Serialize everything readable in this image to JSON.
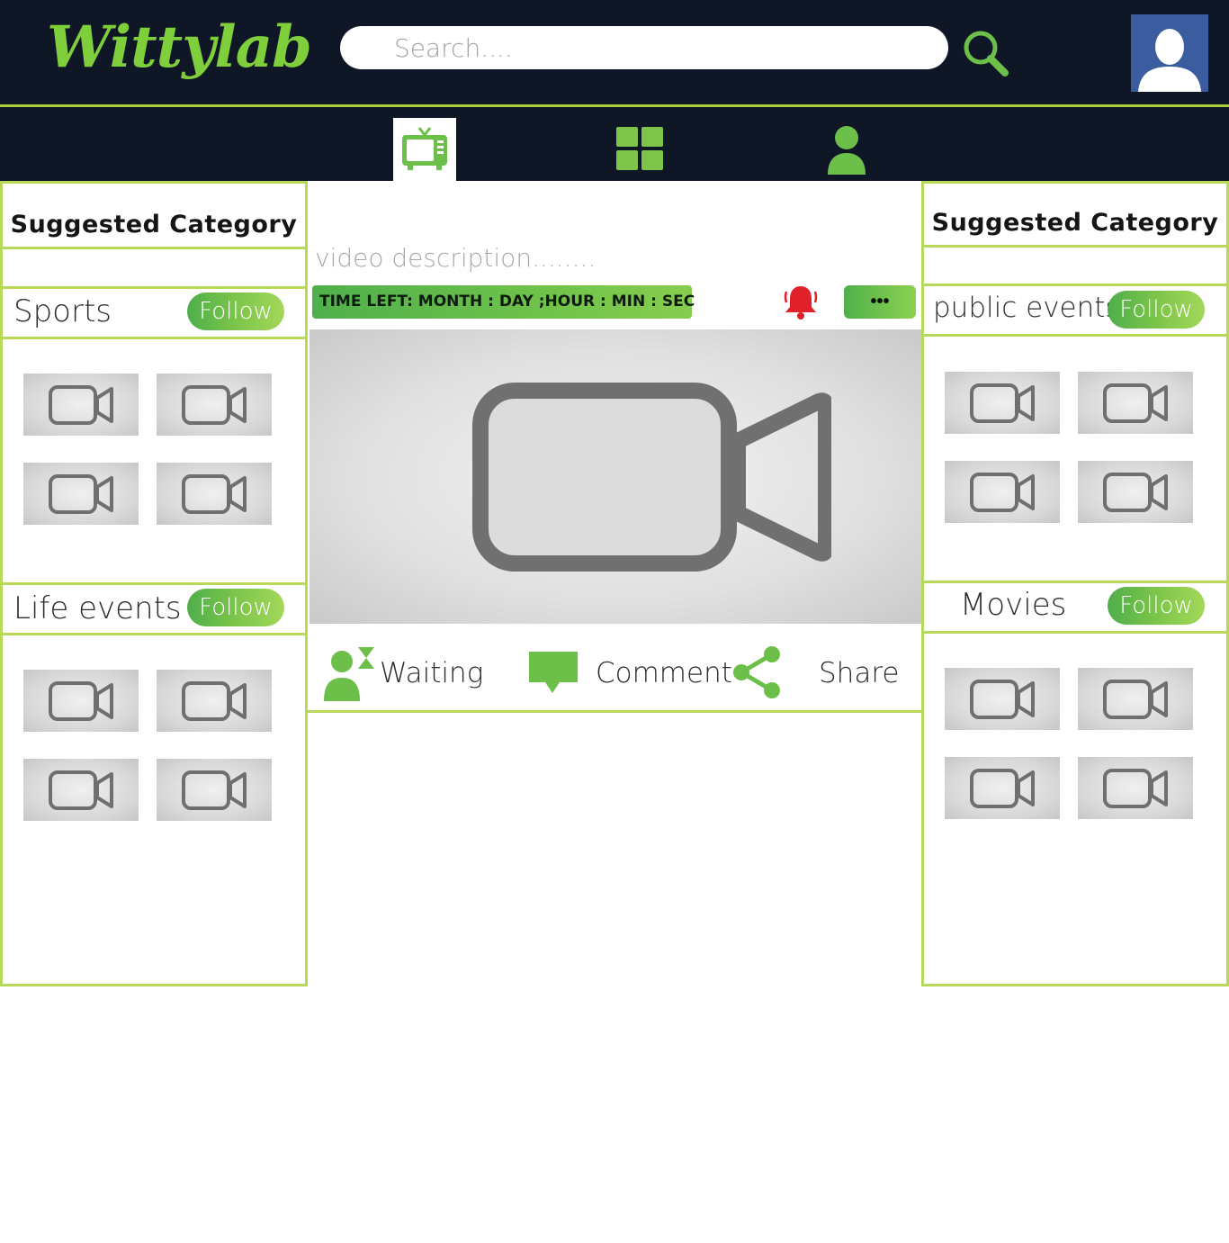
{
  "header": {
    "logo_text": "Wittylab",
    "search_placeholder": "Search....",
    "search_icon": "search-icon",
    "avatar_icon": "user-avatar-icon"
  },
  "nav": {
    "tabs": [
      {
        "icon": "tv-icon",
        "active": true
      },
      {
        "icon": "grid-icon",
        "active": false
      },
      {
        "icon": "profile-icon",
        "active": false
      }
    ]
  },
  "left_panel": {
    "title": "Suggested Category",
    "categories": [
      {
        "name": "Sports",
        "follow_label": "Follow",
        "thumbnails": 4
      },
      {
        "name": "Life events",
        "follow_label": "Follow",
        "thumbnails": 4
      }
    ]
  },
  "right_panel": {
    "title": "Suggested Category",
    "categories": [
      {
        "name": "public events",
        "follow_label": "Follow",
        "thumbnails": 4
      },
      {
        "name": "Movies",
        "follow_label": "Follow",
        "thumbnails": 4
      }
    ]
  },
  "main": {
    "video_description": "video description........",
    "timer_text": "TIME LEFT:  MONTH : DAY ;HOUR : MIN : SEC",
    "bell_icon": "bell-icon",
    "more_label": "•••",
    "player_icon": "video-camera-icon",
    "actions": [
      {
        "label": "Waiting",
        "icon": "waiting-user-icon"
      },
      {
        "label": "Comment",
        "icon": "comment-icon"
      },
      {
        "label": "Share",
        "icon": "share-icon"
      }
    ]
  },
  "colors": {
    "header_bg": "#0f1626",
    "accent_green": "#7cc54a",
    "panel_border": "#b8d85a",
    "bell_red": "#e0202a"
  }
}
